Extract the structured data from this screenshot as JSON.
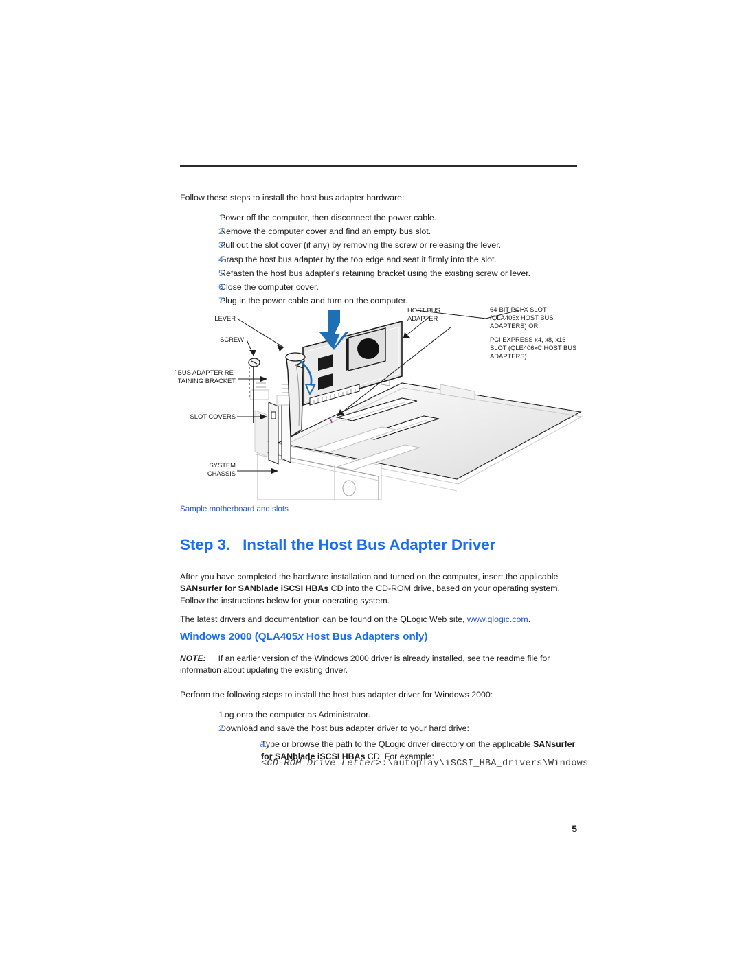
{
  "document": {
    "page_number": "5"
  },
  "intro": {
    "text": "Follow these steps to install the host bus adapter hardware:"
  },
  "hardware_steps": [
    {
      "num": "1.",
      "text": "Power off the computer, then disconnect the power cable."
    },
    {
      "num": "2.",
      "text": "Remove the computer cover and find an empty bus slot."
    },
    {
      "num": "3.",
      "text": "Pull out the slot cover (if any) by removing the screw or releasing the lever."
    },
    {
      "num": "4.",
      "text": "Grasp the host bus adapter by the top edge and seat it firmly into the slot."
    },
    {
      "num": "5.",
      "text": "Refasten the host bus adapter's retaining bracket using the existing screw or lever."
    },
    {
      "num": "6.",
      "text": "Close the computer cover."
    },
    {
      "num": "7.",
      "text": "Plug in the power cable and turn on the computer."
    }
  ],
  "figure": {
    "caption": "Sample motherboard and slots",
    "labels": {
      "lever": "LEVER",
      "screw": "SCREW",
      "retaining_bracket_line1": "HOST BUS ADAPTER RE-",
      "retaining_bracket_line2": "TAINING BRACKET",
      "slot_covers": "SLOT COVERS",
      "system_chassis_line1": "SYSTEM",
      "system_chassis_line2": "CHASSIS",
      "host_bus_adapter_line1": "HOST BUS",
      "host_bus_adapter_line2": "ADAPTER",
      "slot_line1": "64-BIT PCI-X SLOT",
      "slot_line2": "(QLA405x HOST BUS",
      "slot_line3": "ADAPTERS) OR",
      "slot_line4": "PCI EXPRESS x4, x8, x16",
      "slot_line5": "SLOT (QLE406xC HOST BUS",
      "slot_line6": "ADAPTERS)"
    },
    "colors": {
      "arrow_blue": "#1f6fb5",
      "outline": "#1b1b1b",
      "panel_fill": "#e8e8e8"
    }
  },
  "step3": {
    "label": "Step 3.",
    "title": "Install the Host Bus Adapter Driver",
    "paragraph1_part1": "After you have completed the hardware installation and turned on the computer, insert the applicable ",
    "paragraph1_bold1": "SANsurfer for SANblade iSCSI",
    "paragraph1_part2": " ",
    "paragraph1_bold2": "HBAs",
    "paragraph1_part3": " CD into the CD-ROM drive, based on your operating system. Follow the instructions below for your operating system.",
    "paragraph2_part1": "The latest drivers and documentation can be found on the QLogic Web site, ",
    "paragraph2_link": "www.qlogic.com",
    "paragraph2_part2": "."
  },
  "windows_section": {
    "heading_part1": "Windows 2000 (QLA405",
    "heading_italic": "x",
    "heading_part2": " Host Bus Adapters only)",
    "note_label": "NOTE:",
    "note_text": "If an earlier version of the Windows 2000 driver is already installed, see the readme file for information about updating the existing driver.",
    "lead_in": "Perform the following steps to install the host bus adapter driver for Windows 2000:",
    "steps": [
      {
        "num": "1.",
        "text": "Log onto the computer as Administrator."
      },
      {
        "num": "2.",
        "text": "Download and save the host bus adapter driver to your hard drive:"
      }
    ],
    "substep": {
      "num": "a.",
      "text_part1": "Type or browse the path to the QLogic driver directory on the applicable ",
      "bold": "SANsurfer for SANblade iSCSI HBAs",
      "text_part2": " CD. For example:"
    },
    "path_italic": "<CD-ROM Drive Letter>",
    "path_rest": ":\\autoplay\\iSCSI_HBA_drivers\\Windows"
  },
  "colors": {
    "heading_blue": "#1a6ef5",
    "list_number_blue": "#4d86c6",
    "link_blue": "#2b55d4",
    "caption_blue": "#2b55d4",
    "body_black": "#1b1b1b"
  }
}
